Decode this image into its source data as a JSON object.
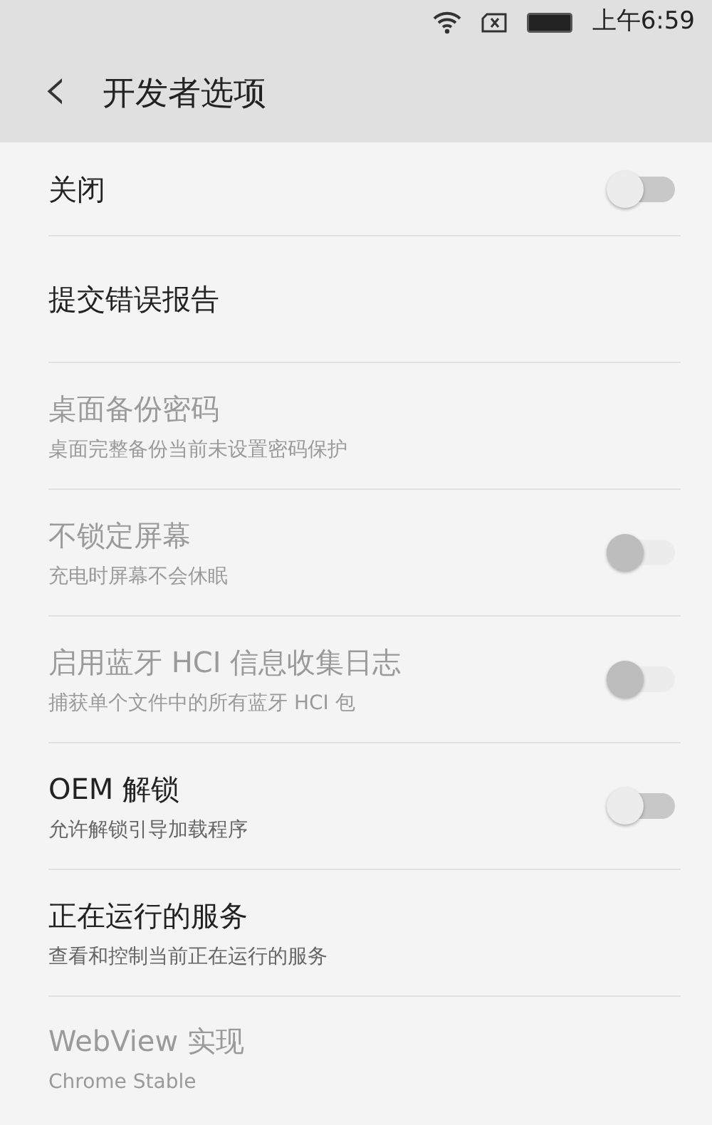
{
  "status_bar": {
    "time": "上午6:59"
  },
  "toolbar": {
    "back": "‹",
    "title": "开发者选项"
  },
  "items": [
    {
      "title": "关闭",
      "disabled": false,
      "toggle": {
        "on": false
      }
    },
    {
      "title": "提交错误报告",
      "disabled": false
    },
    {
      "title": "桌面备份密码",
      "subtitle": "桌面完整备份当前未设置密码保护",
      "disabled": true
    },
    {
      "title": "不锁定屏幕",
      "subtitle": "充电时屏幕不会休眠",
      "disabled": true,
      "toggle": {
        "on": false
      }
    },
    {
      "title": "启用蓝牙 HCI 信息收集日志",
      "subtitle": "捕获单个文件中的所有蓝牙 HCI 包",
      "disabled": true,
      "toggle": {
        "on": false
      }
    },
    {
      "title": "OEM 解锁",
      "subtitle": "允许解锁引导加载程序",
      "disabled": false,
      "toggle": {
        "on": false
      }
    },
    {
      "title": "正在运行的服务",
      "subtitle": "查看和控制当前正在运行的服务",
      "disabled": false
    },
    {
      "title": "WebView 实现",
      "subtitle": "Chrome Stable",
      "disabled": true
    }
  ]
}
